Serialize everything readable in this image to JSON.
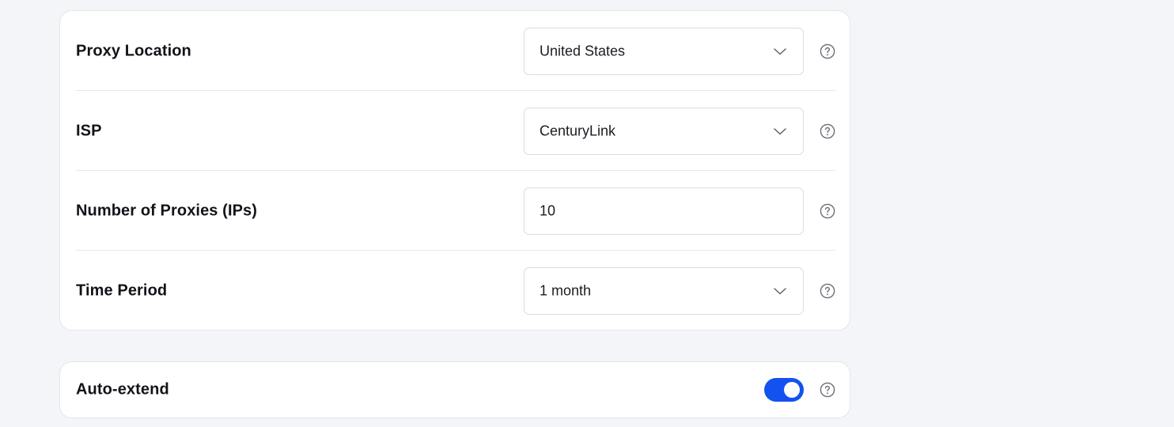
{
  "settings": {
    "proxy_location": {
      "label": "Proxy Location",
      "value": "United States"
    },
    "isp": {
      "label": "ISP",
      "value": "CenturyLink"
    },
    "number_of_proxies": {
      "label": "Number of Proxies (IPs)",
      "value": "10"
    },
    "time_period": {
      "label": "Time Period",
      "value": "1 month"
    }
  },
  "auto_extend": {
    "label": "Auto-extend",
    "enabled": true
  },
  "colors": {
    "background": "#f4f5f9",
    "card": "#ffffff",
    "border": "#e4e6ec",
    "toggle_on": "#1452f0",
    "icon": "#6b6e76"
  },
  "icons": {
    "dropdown": "chevron-down-icon",
    "help": "question-circle-icon"
  }
}
